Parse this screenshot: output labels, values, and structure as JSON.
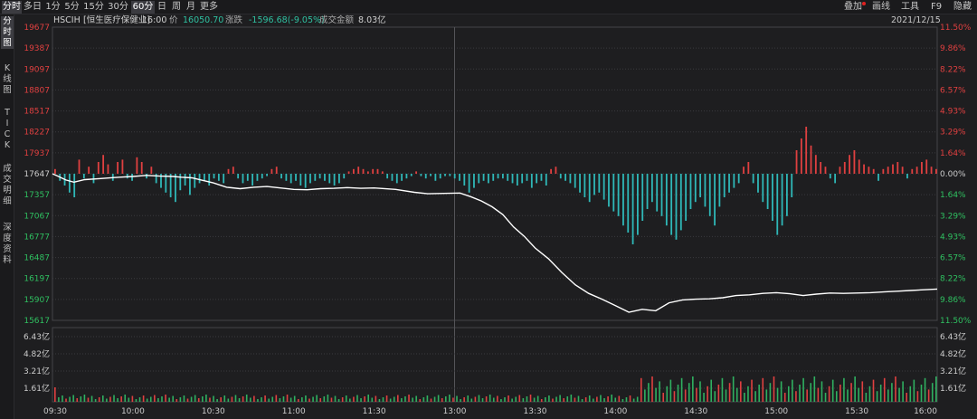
{
  "toolbar": {
    "tabs": [
      "分时",
      "多日",
      "1分",
      "5分",
      "15分",
      "30分",
      "60分",
      "日",
      "周",
      "月",
      "更多"
    ],
    "right": [
      "叠加",
      "画线",
      "工具",
      "F9",
      "隐藏"
    ]
  },
  "sidebar": [
    "分时图",
    "K线图",
    "TICK",
    "成交明细",
    "深度资料"
  ],
  "header": {
    "code": "HSCIH",
    "name": "[恒生医疗保健业]",
    "time": "16:00",
    "price_label": "价",
    "price": "16050.70",
    "change_label": "涨跌",
    "change": "-1596.68(-9.05%)",
    "amount_label": "成交金额",
    "amount": "8.03亿",
    "date": "2021/12/15"
  },
  "colors": {
    "up": "#e04040",
    "down": "#2fb8b8",
    "price_line": "#ffffff",
    "vol_up": "#e04040",
    "vol_down": "#2fb060",
    "grid": "#3a3a3e",
    "background": "#1e1e20",
    "toolbar_active": "#3b3b40"
  },
  "chart_data": {
    "type": "line",
    "x_ticks": [
      "09:30",
      "10:00",
      "10:30",
      "11:00",
      "11:30",
      "13:00",
      "13:30",
      "14:00",
      "14:30",
      "15:00",
      "15:30",
      "16:00"
    ],
    "price_axis_left": [
      "19677",
      "19387",
      "19097",
      "18807",
      "18517",
      "18227",
      "17937",
      "17647",
      "17357",
      "17067",
      "16777",
      "16487",
      "16197",
      "15907",
      "15617"
    ],
    "percent_axis_right": [
      "11.50%",
      "9.86%",
      "8.22%",
      "6.57%",
      "4.93%",
      "3.29%",
      "1.64%",
      "0.00%",
      "1.64%",
      "3.29%",
      "4.93%",
      "6.57%",
      "8.22%",
      "9.86%",
      "11.50%"
    ],
    "ylim": [
      15617,
      19677
    ],
    "prev_close": 17647,
    "volume_axis": [
      "6.43亿",
      "4.82亿",
      "3.21亿",
      "1.61亿"
    ],
    "volume_ylim": [
      0,
      8.03
    ],
    "series": [
      {
        "x": [
          0,
          2,
          5,
          8,
          12,
          18,
          25,
          30,
          35,
          40,
          45,
          48,
          52,
          56,
          60,
          65,
          70,
          75,
          80,
          85,
          90,
          95,
          100,
          105,
          110,
          115,
          120,
          128,
          135,
          140,
          146,
          152,
          156,
          160,
          164,
          168,
          172,
          176,
          180,
          185,
          190,
          195,
          200,
          205,
          210,
          215,
          220,
          225,
          230,
          235,
          240,
          245,
          250,
          255,
          260,
          265,
          270,
          275,
          280,
          285,
          290,
          295,
          300,
          305,
          310,
          315,
          320,
          325,
          330
        ],
        "y": [
          17647,
          17615,
          17560,
          17530,
          17565,
          17580,
          17600,
          17610,
          17625,
          17615,
          17610,
          17600,
          17590,
          17555,
          17520,
          17460,
          17440,
          17460,
          17470,
          17450,
          17430,
          17425,
          17440,
          17445,
          17455,
          17445,
          17450,
          17430,
          17390,
          17370,
          17375,
          17380,
          17330,
          17270,
          17190,
          17080,
          16910,
          16780,
          16620,
          16470,
          16280,
          16110,
          15990,
          15910,
          15820,
          15730,
          15770,
          15750,
          15860,
          15900,
          15910,
          15915,
          15930,
          15960,
          15970,
          15990,
          16000,
          15985,
          15960,
          15980,
          15995,
          15990,
          15995,
          16000,
          16010,
          16020,
          16030,
          16040,
          16050.7
        ]
      }
    ],
    "diff_bars": [
      2,
      -3,
      -5,
      -8,
      -10,
      6,
      -2,
      3,
      -4,
      5,
      8,
      4,
      -3,
      5,
      6,
      -2,
      -3,
      7,
      5,
      -2,
      3,
      -4,
      -6,
      -8,
      -10,
      -12,
      -7,
      -5,
      -9,
      -6,
      -4,
      -3,
      -5,
      -2,
      -3,
      -4,
      2,
      3,
      -2,
      -4,
      -3,
      -5,
      -3,
      -2,
      -1,
      2,
      3,
      -2,
      -3,
      -4,
      -3,
      -5,
      -6,
      -4,
      -3,
      -2,
      -3,
      -4,
      -5,
      -4,
      -2,
      1,
      2,
      3,
      2,
      1,
      2,
      2,
      1,
      -2,
      -3,
      -4,
      -3,
      -2,
      -1,
      1,
      -1,
      -2,
      -1,
      -3,
      -2,
      -1,
      -1,
      -2,
      -3,
      -5,
      -8,
      -6,
      -4,
      -3,
      -4,
      -3,
      -2,
      -2,
      -3,
      -4,
      -5,
      -4,
      -3,
      -6,
      -4,
      -3,
      -5,
      2,
      3,
      -2,
      -3,
      -4,
      -6,
      -8,
      -10,
      -12,
      -9,
      -8,
      -11,
      -14,
      -16,
      -18,
      -22,
      -25,
      -30,
      -26,
      -20,
      -15,
      -12,
      -16,
      -18,
      -22,
      -26,
      -28,
      -24,
      -20,
      -15,
      -12,
      -10,
      -14,
      -18,
      -22,
      -14,
      -10,
      -8,
      -6,
      -4,
      3,
      5,
      -4,
      -8,
      -12,
      -15,
      -20,
      -26,
      -22,
      -18,
      -10,
      10,
      15,
      20,
      12,
      8,
      5,
      3,
      -2,
      -4,
      3,
      5,
      8,
      10,
      6,
      4,
      3,
      2,
      -3,
      2,
      3,
      4,
      5,
      3,
      -2,
      2,
      3,
      5,
      6,
      3,
      2
    ]
  }
}
